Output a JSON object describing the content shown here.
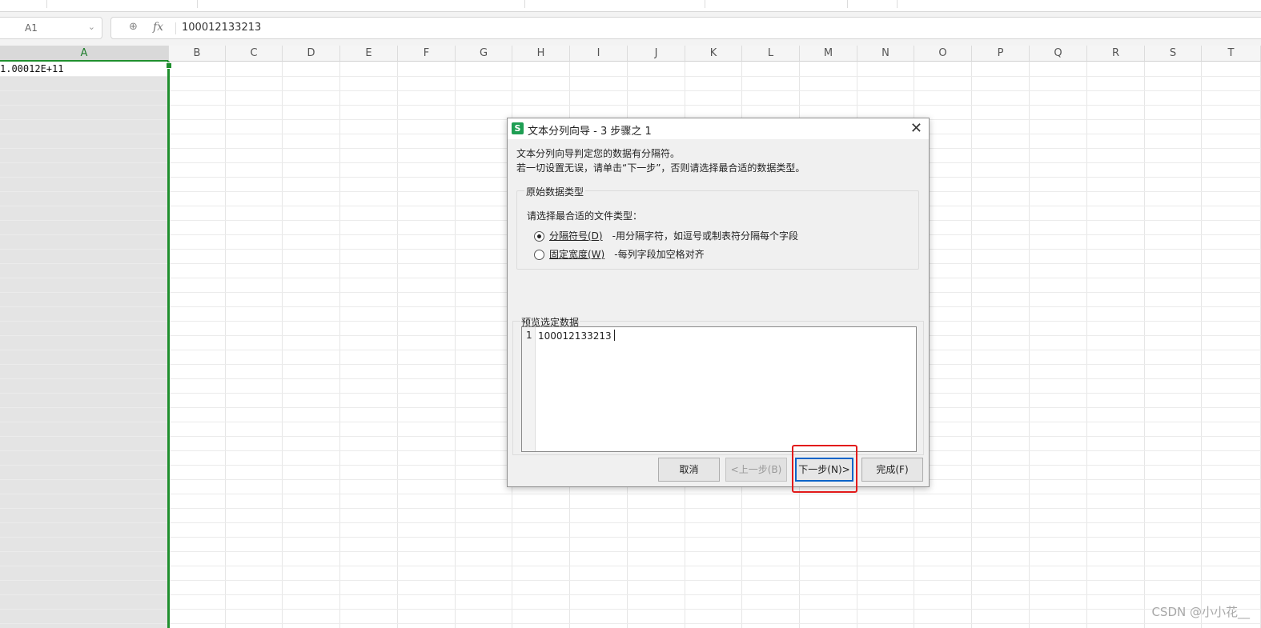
{
  "namebox": {
    "cell": "A1"
  },
  "formula": {
    "value": "100012133213",
    "fx_label": "fx"
  },
  "columns": [
    "A",
    "B",
    "C",
    "D",
    "E",
    "F",
    "G",
    "H",
    "I",
    "J",
    "K",
    "L",
    "M",
    "N",
    "O",
    "P",
    "Q",
    "R",
    "S",
    "T"
  ],
  "cells": {
    "A1": "1.00012E+11"
  },
  "dialog": {
    "app_icon": "S",
    "title": "文本分列向导 - 3 步骤之 1",
    "desc_line1": "文本分列向导判定您的数据有分隔符。",
    "desc_line2": "若一切设置无误，请单击“下一步”，否则请选择最合适的数据类型。",
    "group_original_type": "原始数据类型",
    "prompt": "请选择最合适的文件类型：",
    "options": [
      {
        "label": "分隔符号(D)",
        "hint": "-用分隔字符，如逗号或制表符分隔每个字段",
        "selected": true
      },
      {
        "label": "固定宽度(W)",
        "hint": "-每列字段加空格对齐",
        "selected": false
      }
    ],
    "preview_label": "预览选定数据",
    "preview_rows": [
      {
        "n": "1",
        "text": "100012133213"
      }
    ],
    "buttons": {
      "cancel": "取消",
      "back": "<上一步(B)",
      "next": "下一步(N)>",
      "finish": "完成(F)"
    }
  },
  "watermark": "CSDN @小小花__",
  "colors": {
    "accent_green": "#1f8f2e",
    "highlight_red": "#e21a1a",
    "focus_blue": "#0a64c8"
  }
}
